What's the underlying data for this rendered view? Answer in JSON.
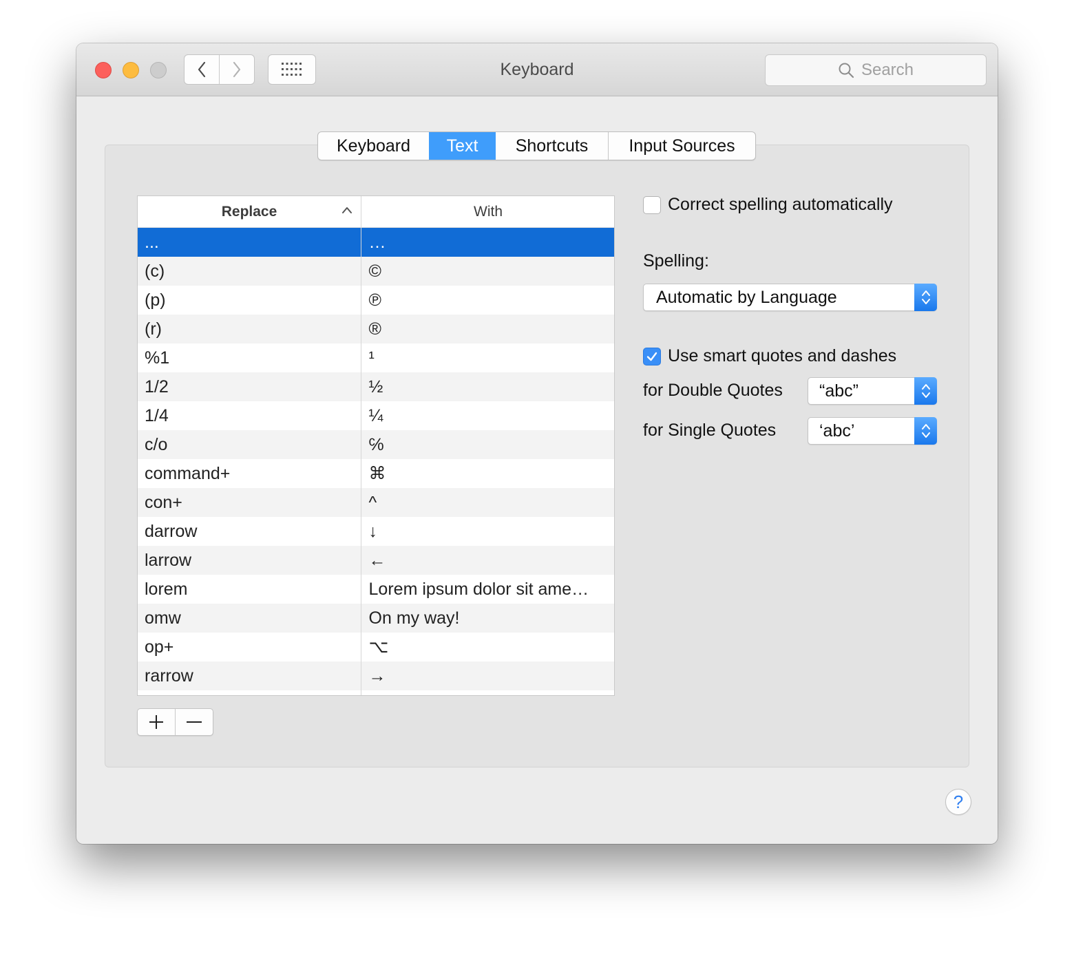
{
  "window": {
    "title": "Keyboard",
    "search_placeholder": "Search"
  },
  "tabs": [
    {
      "label": "Keyboard",
      "active": false
    },
    {
      "label": "Text",
      "active": true
    },
    {
      "label": "Shortcuts",
      "active": false
    },
    {
      "label": "Input Sources",
      "active": false
    }
  ],
  "table": {
    "columns": {
      "replace": "Replace",
      "with": "With"
    },
    "sort": "ascending",
    "selected_row": 0,
    "rows": [
      {
        "replace": "...",
        "with": "…"
      },
      {
        "replace": "(c)",
        "with": "©"
      },
      {
        "replace": "(p)",
        "with": "℗"
      },
      {
        "replace": "(r)",
        "with": "®"
      },
      {
        "replace": "%1",
        "with": "¹"
      },
      {
        "replace": "1/2",
        "with": "½"
      },
      {
        "replace": "1/4",
        "with": "¼"
      },
      {
        "replace": "c/o",
        "with": "℅"
      },
      {
        "replace": "command+",
        "with": "⌘"
      },
      {
        "replace": "con+",
        "with": "^"
      },
      {
        "replace": "darrow",
        "with": "↓"
      },
      {
        "replace": "larrow",
        "with": "←"
      },
      {
        "replace": "lorem",
        "with": "Lorem ipsum dolor sit ame…"
      },
      {
        "replace": "omw",
        "with": "On my way!"
      },
      {
        "replace": "op+",
        "with": "⌥"
      },
      {
        "replace": "rarrow",
        "with": "→"
      }
    ]
  },
  "buttons": {
    "add": "+",
    "remove": "—"
  },
  "options": {
    "correct_spelling_label": "Correct spelling automatically",
    "correct_spelling_checked": false,
    "spelling_label": "Spelling:",
    "spelling_value": "Automatic by Language",
    "smart_quotes_label": "Use smart quotes and dashes",
    "smart_quotes_checked": true,
    "double_quotes_label": "for Double Quotes",
    "double_quotes_value": "“abc”",
    "single_quotes_label": "for Single Quotes",
    "single_quotes_value": "‘abc’"
  },
  "help": "?",
  "colors": {
    "accent": "#3f9dfb",
    "selection": "#116cd6",
    "close": "#fc605c",
    "minimize": "#fdbc40",
    "zoom_disabled": "#cdcdcd"
  }
}
